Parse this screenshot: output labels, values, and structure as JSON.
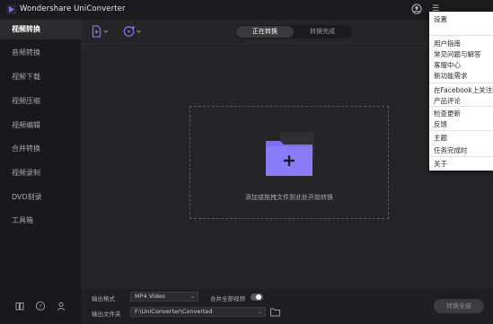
{
  "app": {
    "title": "Wondershare UniConverter"
  },
  "colors": {
    "accent": "#7b6cf6",
    "background": "#252527",
    "sidebar": "#19191b"
  },
  "sidebar": {
    "items": [
      {
        "label": "视频转换",
        "active": true
      },
      {
        "label": "音频转换"
      },
      {
        "label": "视频下载"
      },
      {
        "label": "视频压缩"
      },
      {
        "label": "视频编辑"
      },
      {
        "label": "合并转换"
      },
      {
        "label": "视频录制"
      },
      {
        "label": "DVD刻录"
      },
      {
        "label": "工具箱"
      }
    ],
    "bottom_icons": [
      "book-icon",
      "help-icon",
      "people-icon"
    ]
  },
  "header": {
    "tabs": [
      {
        "label": "正在转换",
        "active": true
      },
      {
        "label": "转换完成"
      }
    ],
    "toolbar_icons": [
      "add-file-icon",
      "add-dvd-icon"
    ]
  },
  "dropzone": {
    "hint": "添加或拖拽文件到此处开始转换"
  },
  "bottom": {
    "output_format_label": "输出格式",
    "output_format_value": "MP4 Video",
    "merge_label": "合并全部视频",
    "merge_enabled": false,
    "output_folder_label": "输出文件夹",
    "output_folder_value": "F:\\UniConverter\\Converted",
    "convert_all_label": "转换全部"
  },
  "menu": {
    "items": [
      "设置",
      "用户指南",
      "常见问题与解答",
      "客服中心",
      "新功能需求",
      "在Facebook上关注我们",
      "产品评论",
      "检查更新",
      "反馈",
      "主题",
      "任务完成时",
      "关于"
    ]
  }
}
